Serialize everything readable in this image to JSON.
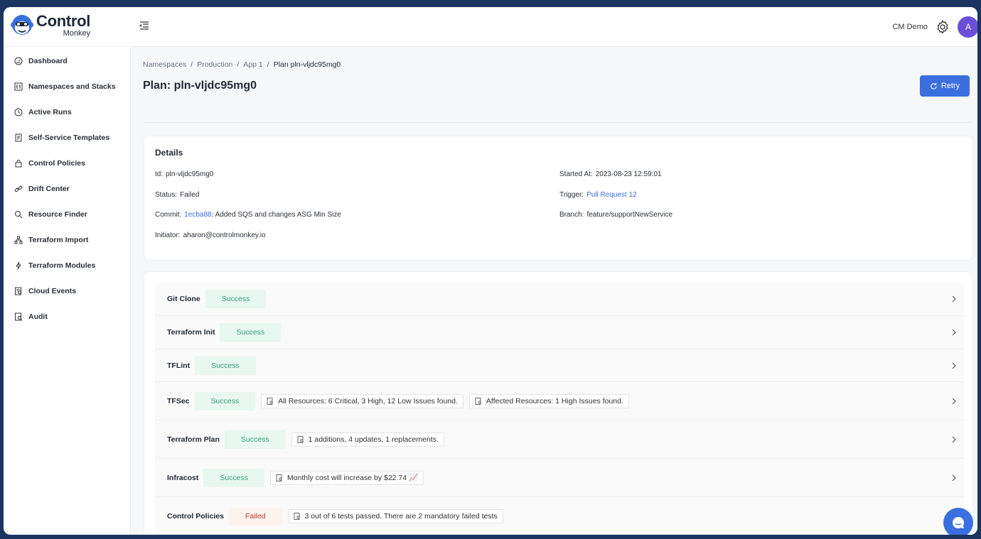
{
  "brand": {
    "title": "Control",
    "subtitle": "Monkey"
  },
  "header": {
    "user_name": "CM Demo",
    "avatar_initial": "A"
  },
  "sidebar": {
    "items": [
      {
        "label": "Dashboard",
        "icon": "dashboard-icon"
      },
      {
        "label": "Namespaces and Stacks",
        "icon": "stacks-icon"
      },
      {
        "label": "Active Runs",
        "icon": "clock-icon"
      },
      {
        "label": "Self-Service Templates",
        "icon": "template-icon"
      },
      {
        "label": "Control Policies",
        "icon": "lock-icon"
      },
      {
        "label": "Drift Center",
        "icon": "link-icon"
      },
      {
        "label": "Resource Finder",
        "icon": "search-icon"
      },
      {
        "label": "Terraform Import",
        "icon": "sitemap-icon"
      },
      {
        "label": "Terraform Modules",
        "icon": "bolt-icon"
      },
      {
        "label": "Cloud Events",
        "icon": "event-icon"
      },
      {
        "label": "Audit",
        "icon": "audit-icon"
      }
    ]
  },
  "breadcrumb": {
    "items": [
      "Namespaces",
      "Production",
      "App 1"
    ],
    "current": "Plan pln-vljdc95mg0"
  },
  "page": {
    "title": "Plan: pln-vljdc95mg0",
    "retry_label": "Retry"
  },
  "details": {
    "heading": "Details",
    "id": {
      "key": "Id:",
      "value": "pln-vljdc95mg0"
    },
    "status": {
      "key": "Status:",
      "value": "Failed"
    },
    "commit": {
      "key": "Commit:",
      "hash": "1ecba88",
      "message": ": Added SQS and changes ASG Min Size"
    },
    "initiator": {
      "key": "Initiator:",
      "value": "aharon@controlmonkey.io"
    },
    "started_at": {
      "key": "Started At:",
      "value": "2023-08-23 12:59:01"
    },
    "trigger": {
      "key": "Trigger:",
      "value": "Pull Request 12"
    },
    "branch": {
      "key": "Branch:",
      "value": "feature/supportNewService"
    }
  },
  "steps": [
    {
      "name": "Git Clone",
      "status": "Success",
      "notes": []
    },
    {
      "name": "Terraform Init",
      "status": "Success",
      "notes": []
    },
    {
      "name": "TFLint",
      "status": "Success",
      "notes": []
    },
    {
      "name": "TFSec",
      "status": "Success",
      "notes": [
        "All Resources: 6 Critical, 3 High, 12 Low Issues found.",
        "Affected Resources: 1 High Issues found."
      ]
    },
    {
      "name": "Terraform Plan",
      "status": "Success",
      "notes": [
        "1 additions, 4 updates, 1 replacements."
      ]
    },
    {
      "name": "Infracost",
      "status": "Success",
      "notes": [
        "Monthly cost will increase by $22.74 📈"
      ]
    },
    {
      "name": "Control Policies",
      "status": "Failed",
      "notes": [
        "3 out of 6 tests passed. There are 2 mandatory failed tests"
      ]
    }
  ],
  "colors": {
    "accent": "#3b6fe0",
    "success": "#34a37a",
    "failed": "#c0392b",
    "frame": "#1d3461"
  }
}
